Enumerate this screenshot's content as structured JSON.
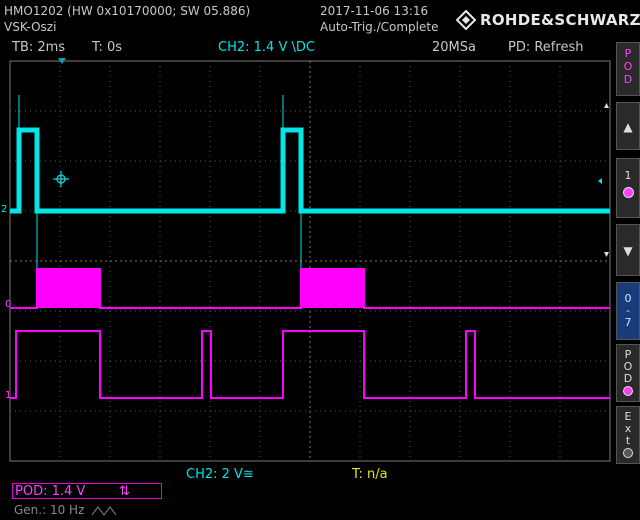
{
  "header": {
    "model_line": "HMO1202 (HW 0x10170000; SW 05.886)",
    "setup_name": "VSK-Oszi",
    "datetime": "2017-11-06 13:16",
    "trigger_status": "Auto-Trig./Complete",
    "brand": "ROHDE&SCHWARZ"
  },
  "status_bar": {
    "timebase": "TB: 2ms",
    "trigger_time": "T: 0s",
    "trigger_source": "CH2: 1.4 V \\DC",
    "sample_rate": "20MSa",
    "pd": "PD: Refresh"
  },
  "side_menu": {
    "pod_top": [
      "P",
      "O",
      "D"
    ],
    "up_arrow": "▲",
    "channel_one": "1",
    "down_arrow": "▼",
    "range": [
      "0",
      "-",
      "7"
    ],
    "pod_mid": [
      "P",
      "O",
      "D"
    ],
    "ext": [
      "E",
      "x",
      "t"
    ]
  },
  "waveform_labels": {
    "ch2_marker": "2",
    "pod_bit0": "0",
    "pod_bit1": "1"
  },
  "bottom_bar": {
    "ch2_scale": "CH2: 2 V≅",
    "trigger": "T: n/a",
    "pod_threshold": "POD: 1.4 V",
    "pod_arrows": "⇅",
    "generator": "Gen.: 10 Hz"
  },
  "colors": {
    "ch2": "#00e5e5",
    "pod": "#ff00ff",
    "trigger_text": "#e8e800",
    "grid": "#5a5a5a"
  },
  "traces": {
    "ch2_high_intervals_ms": [
      [
        0.3,
        0.9
      ],
      [
        9.1,
        9.7
      ]
    ],
    "pod0_high_intervals_ms": [
      [
        0.9,
        3.0
      ],
      [
        9.7,
        11.8
      ]
    ],
    "pod1_high_intervals_ms": [
      [
        0.2,
        3.0
      ],
      [
        6.4,
        6.7
      ],
      [
        9.1,
        11.8
      ],
      [
        15.2,
        15.5
      ]
    ],
    "time_span_ms": 20
  }
}
